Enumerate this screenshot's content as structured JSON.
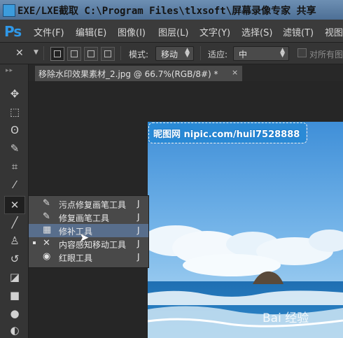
{
  "window": {
    "title": "EXE/LXE截取 C:\\Program Files\\tlxsoft\\屏幕录像专家 共享"
  },
  "menubar": {
    "logo": "Ps",
    "items": [
      "文件(F)",
      "编辑(E)",
      "图像(I)",
      "图层(L)",
      "文字(Y)",
      "选择(S)",
      "滤镜(T)",
      "视图"
    ]
  },
  "options": {
    "mode_label": "模式:",
    "mode_value": "移动",
    "adapt_label": "适应:",
    "adapt_value": "中",
    "sample_all_label": "对所有图"
  },
  "document": {
    "tab_title": "移除水印效果素材_2.jpg @ 66.7%(RGB/8#) *",
    "close_glyph": "×"
  },
  "canvas": {
    "watermark_text": "昵图网 nipic.com/huil7528888",
    "baidu_text": "Bai 经验"
  },
  "flyout": {
    "items": [
      {
        "label": "污点修复画笔工具",
        "shortcut": "J",
        "icon": "spot-healing-brush-icon",
        "glyph": "✎",
        "selected": false,
        "highlighted": false
      },
      {
        "label": "修复画笔工具",
        "shortcut": "J",
        "icon": "healing-brush-icon",
        "glyph": "✎",
        "selected": false,
        "highlighted": false
      },
      {
        "label": "修补工具",
        "shortcut": "J",
        "icon": "patch-icon",
        "glyph": "▦",
        "selected": false,
        "highlighted": true
      },
      {
        "label": "内容感知移动工具",
        "shortcut": "J",
        "icon": "content-aware-move-icon",
        "glyph": "✕",
        "selected": true,
        "highlighted": false
      },
      {
        "label": "红眼工具",
        "shortcut": "J",
        "icon": "red-eye-icon",
        "glyph": "◉",
        "selected": false,
        "highlighted": false
      }
    ]
  },
  "colors": {
    "accent": "#2f98e8",
    "highlight": "#586e8c",
    "background": "#262626"
  }
}
